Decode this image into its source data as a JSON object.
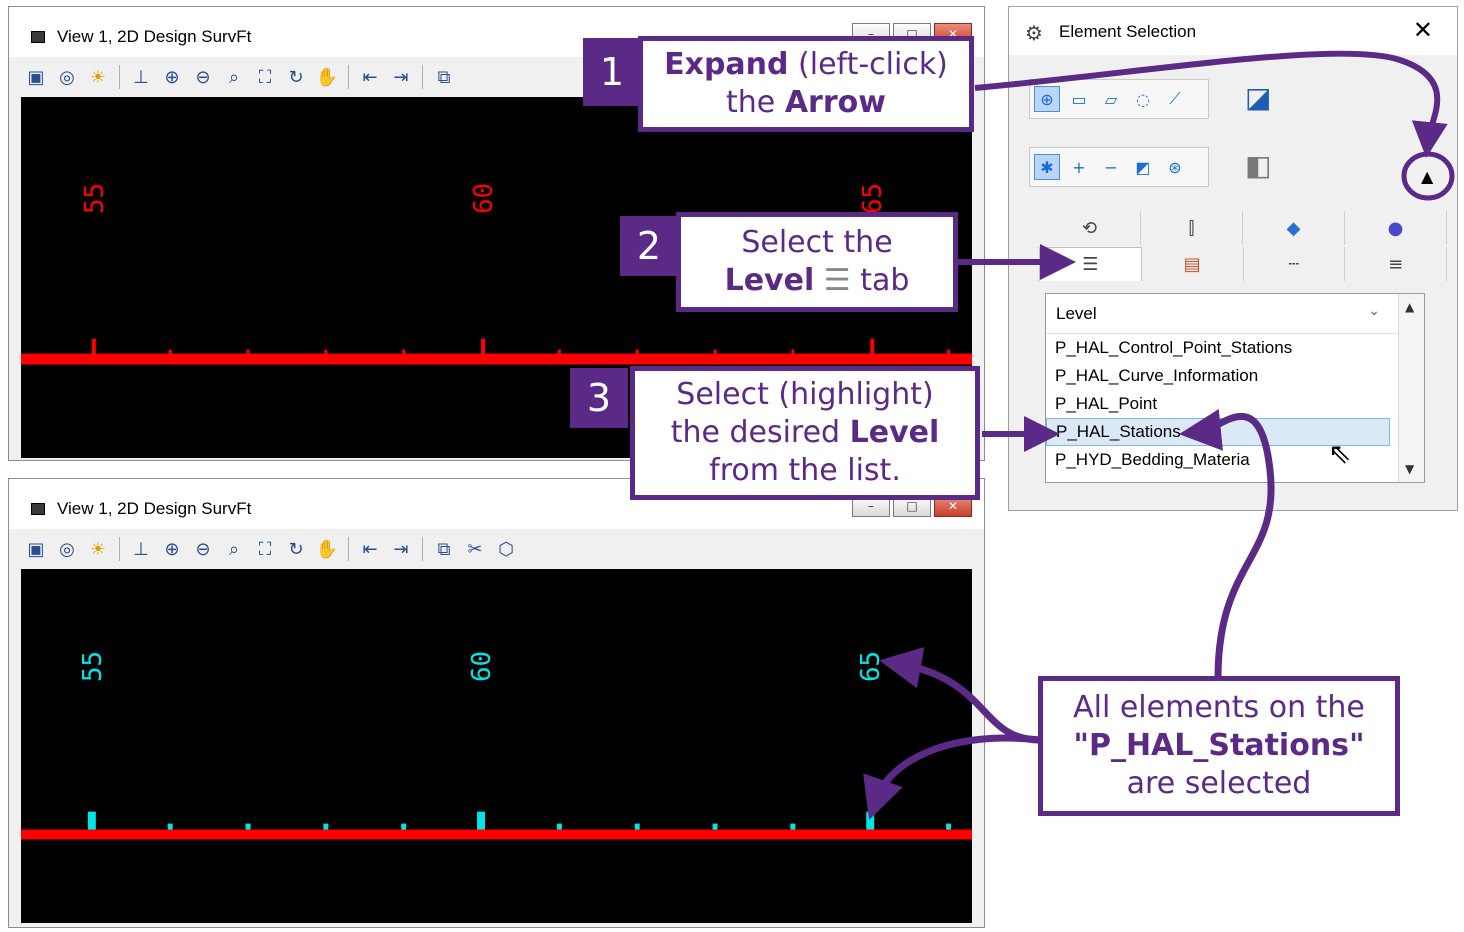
{
  "views": {
    "top": {
      "title": "View 1, 2D Design SurvFt",
      "labels": [
        "55",
        "60",
        "65"
      ],
      "label_color": "#ff0000"
    },
    "bottom": {
      "title": "View 1, 2D Design SurvFt",
      "labels": [
        "55",
        "60",
        "65"
      ],
      "label_color": "#00e5e5"
    },
    "window_buttons": {
      "minimize": "–",
      "maximize": "□",
      "close": "✕"
    }
  },
  "toolbar_icons": [
    "view-attributes-icon",
    "display-style-icon",
    "lighting-icon",
    "level-display-icon",
    "zoom-in-icon",
    "zoom-out-icon",
    "window-area-icon",
    "fit-view-icon",
    "rotate-icon",
    "pan-icon",
    "previous-view-icon",
    "next-view-icon",
    "copy-view-icon",
    "clip-volume-icon",
    "clip-mask-icon"
  ],
  "element_selection": {
    "title": "Element Selection",
    "close": "✕",
    "level_tab_label": "Level",
    "list_header": "Level",
    "levels": [
      "P_HAL_Control_Point_Stations",
      "P_HAL_Curve_Information",
      "P_HAL_Point",
      "P_HAL_Stations",
      "P_HYD_Bedding_Materia"
    ],
    "selected_level": "P_HAL_Stations"
  },
  "callouts": {
    "step1": {
      "number": "1",
      "bold1": "Expand",
      "text1": " (left-click)",
      "text2": "the ",
      "bold2": "Arrow"
    },
    "step2": {
      "number": "2",
      "text1": "Select the",
      "bold1": "Level",
      "text2": " tab"
    },
    "step3": {
      "number": "3",
      "text1": "Select (highlight)",
      "text2": "the desired ",
      "bold1": "Level",
      "text3": "from the list."
    },
    "result": {
      "text1": "All elements on the",
      "bold1": "\"P_HAL_Stations\"",
      "text2": "are selected"
    }
  },
  "colors": {
    "callout": "#5b2a86",
    "ruler": "#ff0000",
    "selected": "#00e5e5"
  }
}
